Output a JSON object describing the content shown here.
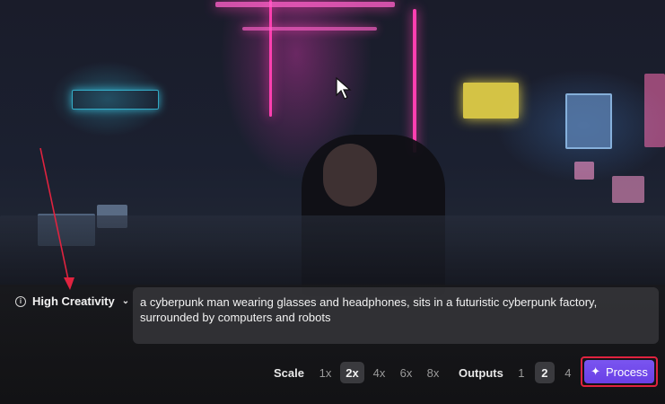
{
  "creativity": {
    "label": "High Creativity",
    "icon": "info-icon",
    "dropdown_icon": "chevron-down-icon"
  },
  "prompt": {
    "text": "a cyberpunk man wearing glasses and headphones, sits in a futuristic cyberpunk factory, surrounded by computers and robots"
  },
  "scale": {
    "label": "Scale",
    "options": [
      "1x",
      "2x",
      "4x",
      "6x",
      "8x"
    ],
    "selected": "2x"
  },
  "outputs": {
    "label": "Outputs",
    "options": [
      "1",
      "2",
      "4"
    ],
    "selected": "2"
  },
  "process_button": {
    "label": "Process",
    "icon": "sparkle-icon"
  },
  "colors": {
    "accent": "#6a3fe6",
    "highlight_border": "#e0233f",
    "annotation_arrow": "#e0233f"
  }
}
